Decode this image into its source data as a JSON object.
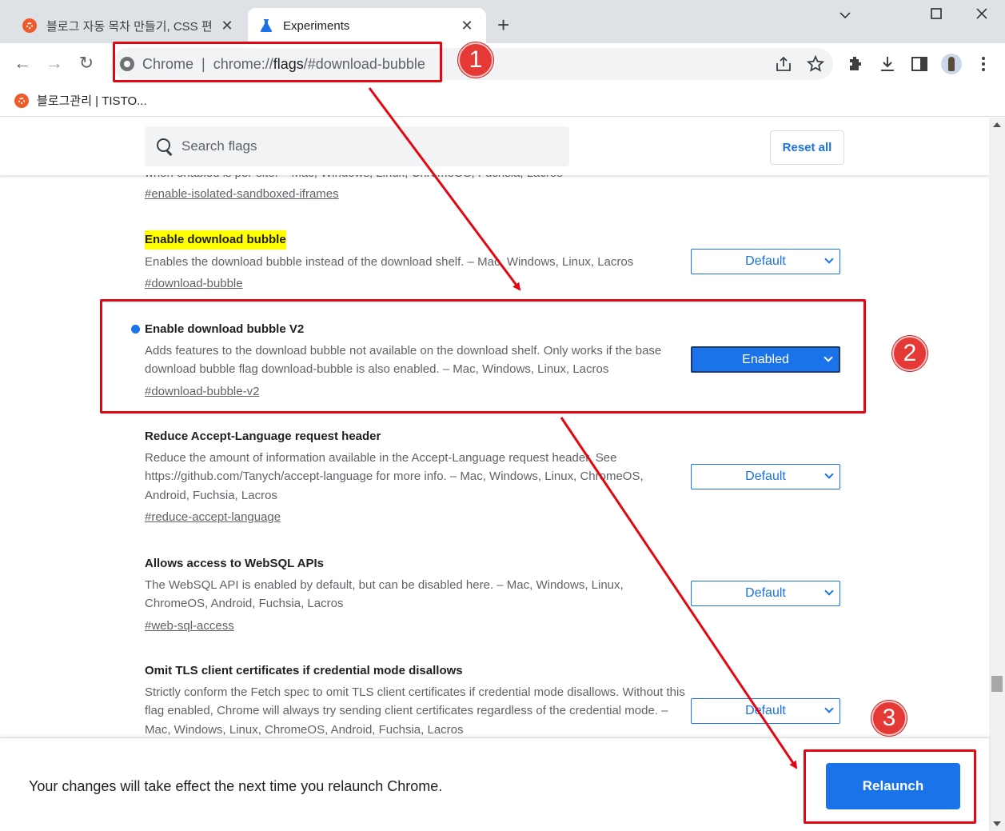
{
  "tabs": [
    {
      "title": "블로그 자동 목차 만들기, CSS 편",
      "active": false
    },
    {
      "title": "Experiments",
      "active": true
    }
  ],
  "new_tab_symbol": "+",
  "window_controls": {
    "minimize": "﹀",
    "maximize": "☐",
    "close": "✕"
  },
  "toolbar": {
    "back": "←",
    "forward": "→",
    "reload": "↻",
    "omnibox_scheme": "Chrome",
    "omnibox_url_prefix": "chrome://",
    "omnibox_url_host": "flags",
    "omnibox_url_rest": "/#download-bubble",
    "icons": [
      "share-icon",
      "star-icon",
      "extensions-icon",
      "download-icon",
      "side-panel-icon",
      "avatar",
      "menu-icon"
    ]
  },
  "bookmarks": [
    {
      "label": "블로그관리 | TISTO..."
    }
  ],
  "flags_page": {
    "search_placeholder": "Search flags",
    "reset_label": "Reset all",
    "partial_text": "when enabled is per-site. – Mac, Windows, Linux, ChromeOS, Fuchsia, Lacros",
    "partial_link": "#enable-isolated-sandboxed-iframes",
    "experiments": [
      {
        "title": "Enable download bubble",
        "highlighted": true,
        "modified": false,
        "description": "Enables the download bubble instead of the download shelf. – Mac, Windows, Linux, Lacros",
        "link": "#download-bubble",
        "value": "Default"
      },
      {
        "title": "Enable download bubble V2",
        "highlighted": false,
        "modified": true,
        "description": "Adds features to the download bubble not available on the download shelf. Only works if the base download bubble flag download-bubble is also enabled. – Mac, Windows, Linux, Lacros",
        "link": "#download-bubble-v2",
        "value": "Enabled"
      },
      {
        "title": "Reduce Accept-Language request header",
        "highlighted": false,
        "modified": false,
        "description": "Reduce the amount of information available in the Accept-Language request header. See https://github.com/Tanych/accept-language for more info. – Mac, Windows, Linux, ChromeOS, Android, Fuchsia, Lacros",
        "link": "#reduce-accept-language",
        "value": "Default"
      },
      {
        "title": "Allows access to WebSQL APIs",
        "highlighted": false,
        "modified": false,
        "description": "The WebSQL API is enabled by default, but can be disabled here. – Mac, Windows, Linux, ChromeOS, Android, Fuchsia, Lacros",
        "link": "#web-sql-access",
        "value": "Default"
      },
      {
        "title": "Omit TLS client certificates if credential mode disallows",
        "highlighted": false,
        "modified": false,
        "description": "Strictly conform the Fetch spec to omit TLS client certificates if credential mode disallows. Without this flag enabled, Chrome will always try sending client certificates regardless of the credential mode. – Mac, Windows, Linux, ChromeOS, Android, Fuchsia, Lacros",
        "link": "",
        "value": "Default"
      }
    ]
  },
  "footer": {
    "message": "Your changes will take effect the next time you relaunch Chrome.",
    "relaunch_label": "Relaunch"
  },
  "annotations": {
    "badges": [
      "1",
      "2",
      "3"
    ],
    "color": "#e30613"
  }
}
